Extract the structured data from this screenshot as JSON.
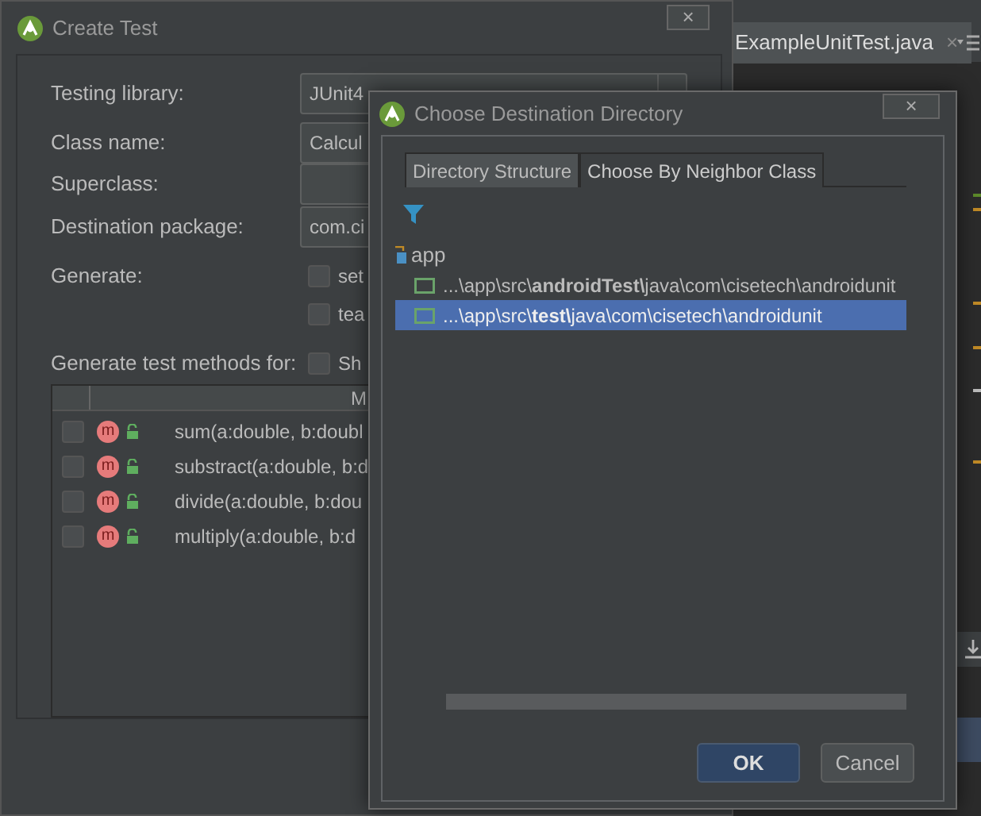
{
  "ide": {
    "editor_tab": {
      "label": "ExampleUnitTest.java",
      "close": "×"
    }
  },
  "create_test": {
    "title": "Create Test",
    "close": "×",
    "fields": [
      {
        "label": "Testing library:",
        "kind": "combo",
        "value": "JUnit4"
      },
      {
        "label": "Class name:",
        "kind": "text",
        "value": "Calcul"
      },
      {
        "label": "Superclass:",
        "kind": "text"
      },
      {
        "label": "Destination package:",
        "kind": "text",
        "value": "com.ci"
      }
    ],
    "generate": {
      "label": "Generate:",
      "options": [
        {
          "label": "set",
          "checked": false
        },
        {
          "label": "tea",
          "checked": false
        }
      ]
    },
    "methods_for": {
      "label": "Generate test methods for:",
      "option": {
        "label": "Sh",
        "checked": false
      }
    },
    "table": {
      "columns": [
        "",
        "M"
      ],
      "rows": [
        {
          "badge": "m",
          "signature": "sum(a:double, b:doubl",
          "checked": false
        },
        {
          "badge": "m",
          "signature": "substract(a:double, b:d",
          "checked": false
        },
        {
          "badge": "m",
          "signature": "divide(a:double, b:dou",
          "checked": false
        },
        {
          "badge": "m",
          "signature": "multiply(a:double, b:d",
          "checked": false
        }
      ]
    }
  },
  "choose_directory": {
    "title": "Choose Destination Directory",
    "close": "×",
    "tabs": [
      {
        "label": "Directory Structure",
        "selected": true
      },
      {
        "label": "Choose By Neighbor Class",
        "selected": false
      }
    ],
    "tree": [
      {
        "label": "app",
        "children": [
          {
            "label": "...\\app\\src\\**androidTest\\**java\\com\\cisetech\\androidunit",
            "selected": false
          },
          {
            "label": "...\\app\\src\\**test\\**java\\com\\cisetech\\androidunit",
            "selected": true
          }
        ]
      }
    ],
    "buttons": [
      {
        "label": "OK",
        "kind": "default"
      },
      {
        "label": "Cancel",
        "kind": "normal"
      }
    ]
  }
}
